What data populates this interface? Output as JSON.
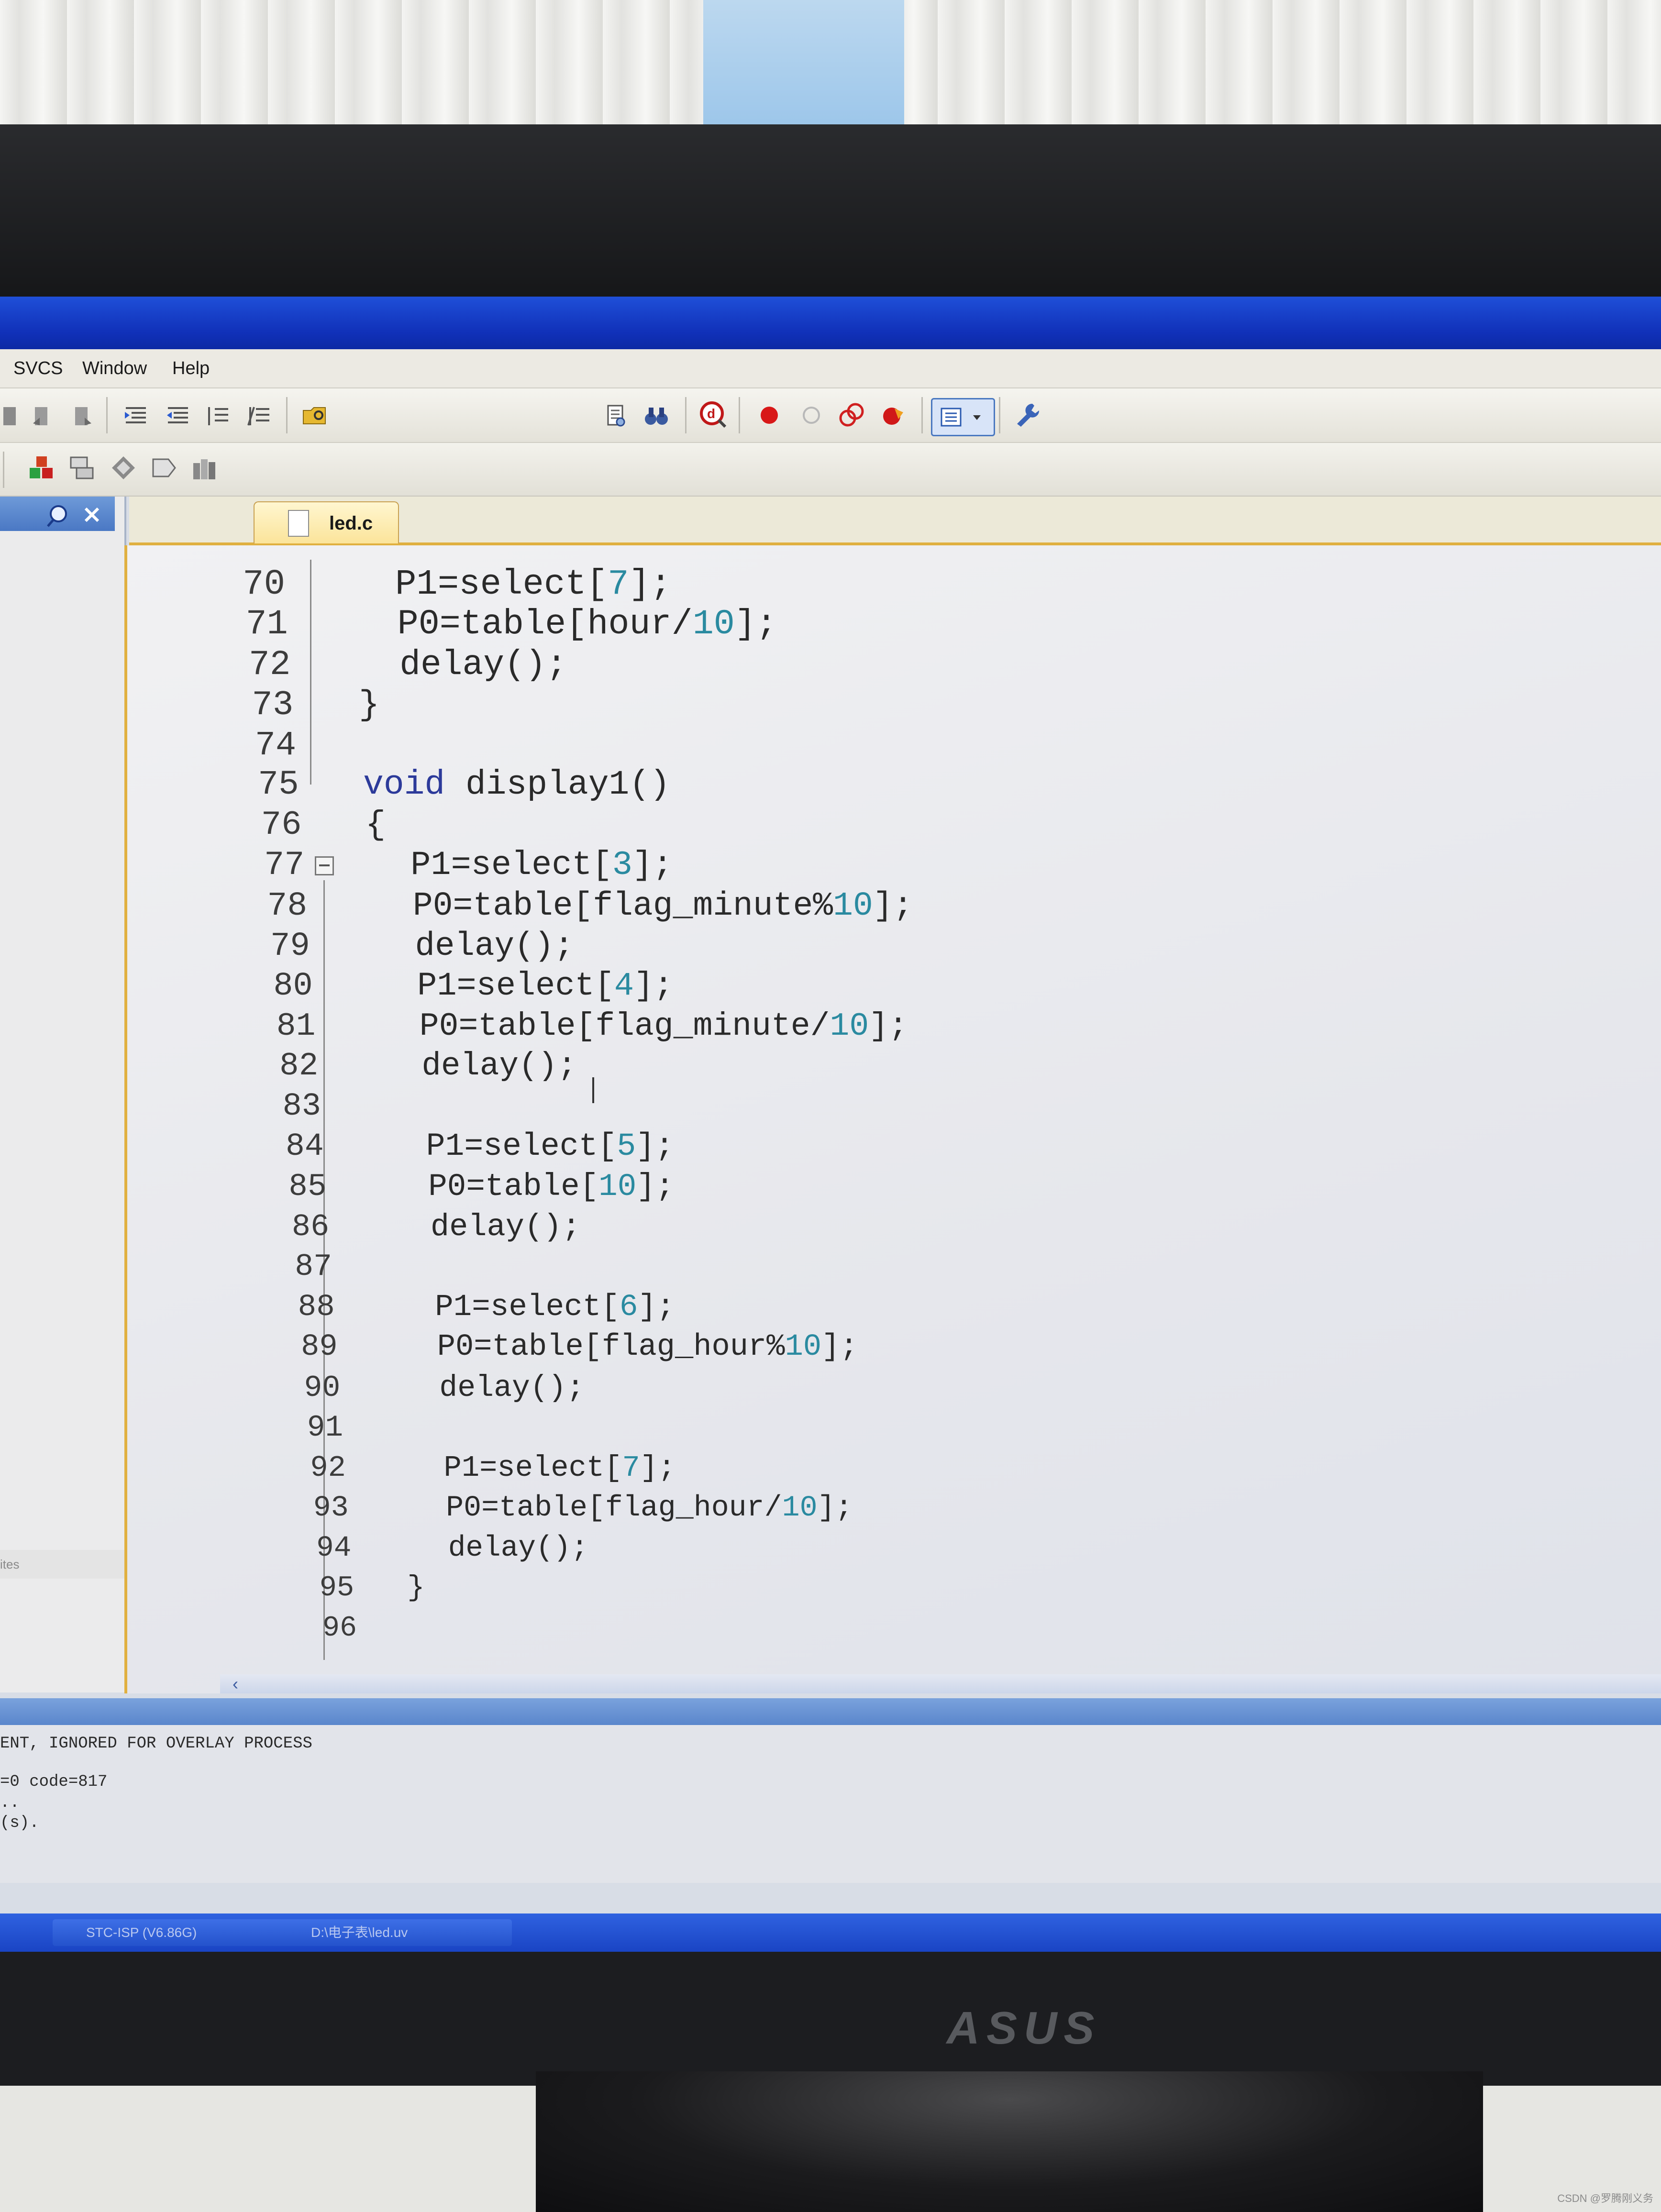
{
  "menu": [
    "SVCS",
    "Window",
    "Help"
  ],
  "tab": {
    "label": "led.c"
  },
  "code": [
    {
      "n": "70",
      "parts": [
        [
          "t",
          "P1=select["
        ],
        [
          "n",
          "7"
        ],
        [
          "t",
          "];"
        ]
      ]
    },
    {
      "n": "71",
      "parts": [
        [
          "t",
          "P0=table[hour/"
        ],
        [
          "n",
          "10"
        ],
        [
          "t",
          "];"
        ]
      ]
    },
    {
      "n": "72",
      "parts": [
        [
          "t",
          "delay();"
        ]
      ]
    },
    {
      "n": "73",
      "parts": [
        [
          "t",
          "}"
        ]
      ]
    },
    {
      "n": "74",
      "parts": []
    },
    {
      "n": "75",
      "parts": [
        [
          "k",
          "void"
        ],
        [
          "t",
          " display1()"
        ]
      ]
    },
    {
      "n": "76",
      "parts": [
        [
          "t",
          "{"
        ]
      ]
    },
    {
      "n": "77",
      "parts": [
        [
          "t",
          "P1=select["
        ],
        [
          "n",
          "3"
        ],
        [
          "t",
          "];"
        ]
      ]
    },
    {
      "n": "78",
      "parts": [
        [
          "t",
          "P0=table[flag_minute%"
        ],
        [
          "n",
          "10"
        ],
        [
          "t",
          "];"
        ]
      ]
    },
    {
      "n": "79",
      "parts": [
        [
          "t",
          "delay();"
        ]
      ]
    },
    {
      "n": "80",
      "parts": [
        [
          "t",
          "P1=select["
        ],
        [
          "n",
          "4"
        ],
        [
          "t",
          "];"
        ]
      ]
    },
    {
      "n": "81",
      "parts": [
        [
          "t",
          "P0=table[flag_minute/"
        ],
        [
          "n",
          "10"
        ],
        [
          "t",
          "];"
        ]
      ]
    },
    {
      "n": "82",
      "parts": [
        [
          "t",
          "delay();"
        ]
      ]
    },
    {
      "n": "83",
      "parts": []
    },
    {
      "n": "84",
      "parts": [
        [
          "t",
          "P1=select["
        ],
        [
          "n",
          "5"
        ],
        [
          "t",
          "];"
        ]
      ]
    },
    {
      "n": "85",
      "parts": [
        [
          "t",
          "P0=table["
        ],
        [
          "n",
          "10"
        ],
        [
          "t",
          "];"
        ]
      ]
    },
    {
      "n": "86",
      "parts": [
        [
          "t",
          "delay();"
        ]
      ]
    },
    {
      "n": "87",
      "parts": []
    },
    {
      "n": "88",
      "parts": [
        [
          "t",
          "P1=select["
        ],
        [
          "n",
          "6"
        ],
        [
          "t",
          "];"
        ]
      ]
    },
    {
      "n": "89",
      "parts": [
        [
          "t",
          "P0=table[flag_hour%"
        ],
        [
          "n",
          "10"
        ],
        [
          "t",
          "];"
        ]
      ]
    },
    {
      "n": "90",
      "parts": [
        [
          "t",
          "delay();"
        ]
      ]
    },
    {
      "n": "91",
      "parts": []
    },
    {
      "n": "92",
      "parts": [
        [
          "t",
          "P1=select["
        ],
        [
          "n",
          "7"
        ],
        [
          "t",
          "];"
        ]
      ]
    },
    {
      "n": "93",
      "parts": [
        [
          "t",
          "P0=table[flag_hour/"
        ],
        [
          "n",
          "10"
        ],
        [
          "t",
          "];"
        ]
      ]
    },
    {
      "n": "94",
      "parts": [
        [
          "t",
          "delay();"
        ]
      ]
    },
    {
      "n": "95",
      "parts": [
        [
          "t",
          "}"
        ]
      ]
    },
    {
      "n": "96",
      "parts": []
    }
  ],
  "output": [
    "ENT, IGNORED FOR OVERLAY PROCESS",
    "=0 code=817",
    "..",
    "(s)."
  ],
  "left_panel_footer": "ites",
  "taskbar": [
    "STC-ISP (V6.86G)",
    "D:\\电子表\\led.uv"
  ],
  "brand": "ASUS",
  "watermark": "CSDN @罗腾刚义务"
}
